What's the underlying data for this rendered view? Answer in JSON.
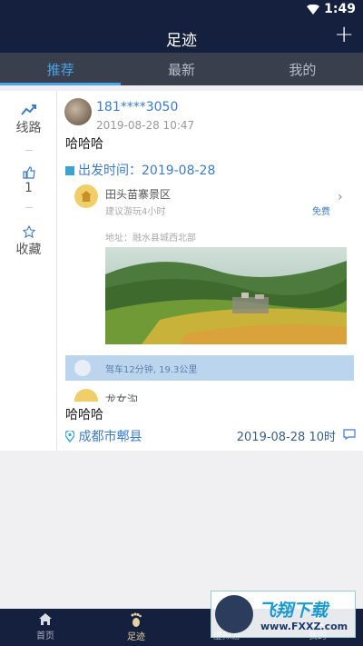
{
  "status_bar": {
    "time": "1:49"
  },
  "header": {
    "title": "足迹",
    "add_label": "+"
  },
  "tabs": [
    {
      "label": "推荐",
      "active": true
    },
    {
      "label": "最新",
      "active": false
    },
    {
      "label": "我的",
      "active": false
    }
  ],
  "post": {
    "side": {
      "route_label": "线路",
      "like_count": "1",
      "favorite_label": "收藏"
    },
    "user_name": "181****3050",
    "time": "2019-08-28 10:47",
    "title": "哈哈哈",
    "departure": "出发时间：2019-08-28",
    "spot": {
      "name": "田头苗寨景区",
      "suggestion": "建议游玩4小时",
      "fee": "免费",
      "address": "地址：融水县城西北部"
    },
    "drive_info": "驾车12分钟, 19.3公里",
    "next_spot": "龙女沟",
    "body": "哈哈哈",
    "location": "成都市郫县",
    "date": "2019-08-28 10时"
  },
  "bottom_nav": [
    {
      "label": "首页",
      "icon": "home-icon",
      "active": false
    },
    {
      "label": "足迹",
      "icon": "footprint-icon",
      "active": true
    },
    {
      "label": "虚拟游",
      "icon": "virtual-tour-icon",
      "active": false
    },
    {
      "label": "我的",
      "icon": "user-icon",
      "active": false
    }
  ],
  "watermark": {
    "title": "飞翔下载",
    "url": "www.FXXZ.com"
  },
  "colors": {
    "navy": "#14203d",
    "accent": "#4aa3e8",
    "link": "#3c7bc8"
  }
}
